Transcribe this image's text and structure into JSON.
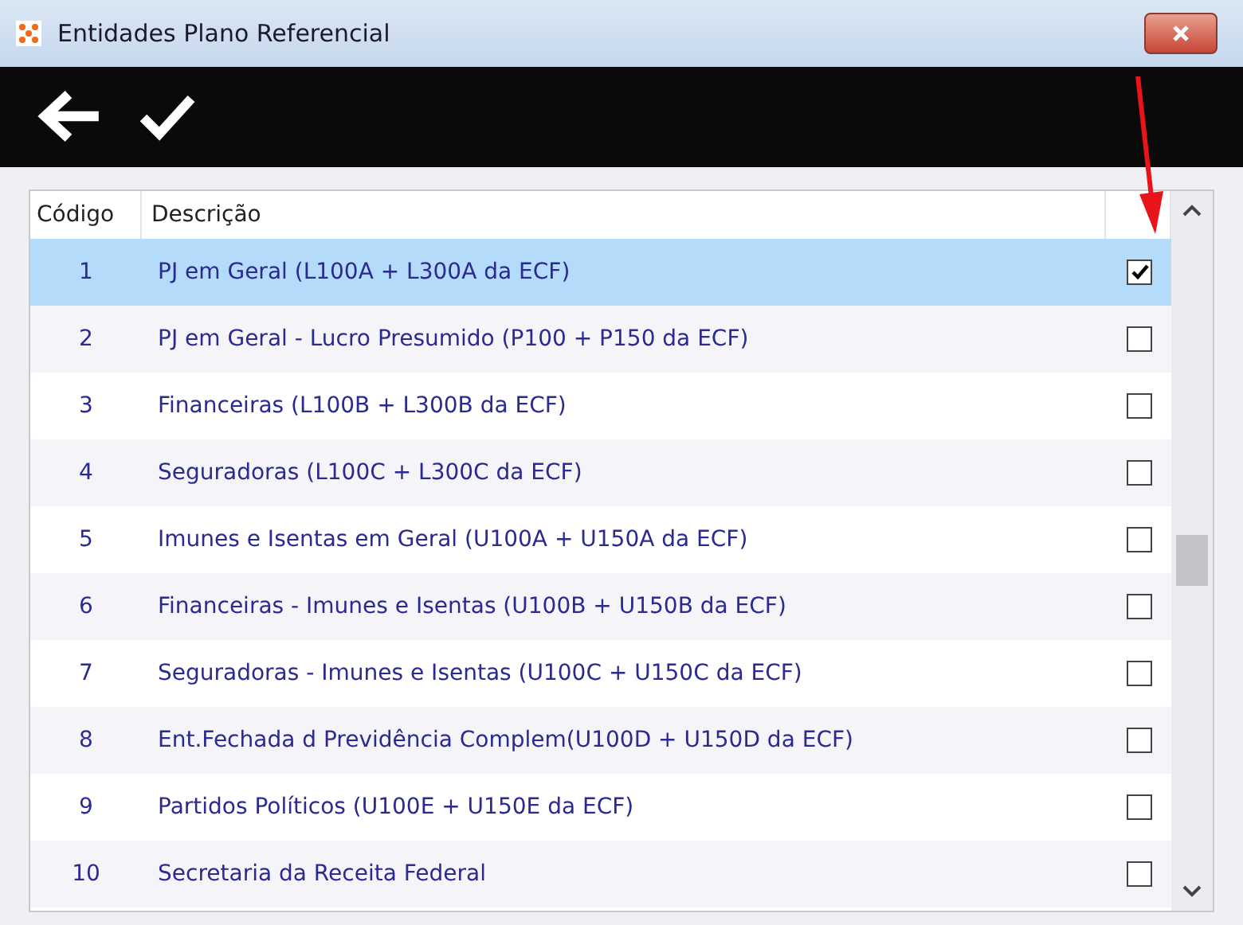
{
  "window": {
    "title": "Entidades Plano Referencial"
  },
  "table": {
    "columns": [
      "Código",
      "Descrição"
    ],
    "rows": [
      {
        "code": "1",
        "description": "PJ em Geral (L100A + L300A da ECF)",
        "checked": true,
        "selected": true
      },
      {
        "code": "2",
        "description": "PJ em Geral - Lucro Presumido (P100 + P150 da ECF)",
        "checked": false,
        "selected": false
      },
      {
        "code": "3",
        "description": "Financeiras (L100B + L300B da ECF)",
        "checked": false,
        "selected": false
      },
      {
        "code": "4",
        "description": "Seguradoras (L100C + L300C da ECF)",
        "checked": false,
        "selected": false
      },
      {
        "code": "5",
        "description": "Imunes e Isentas em Geral (U100A + U150A da ECF)",
        "checked": false,
        "selected": false
      },
      {
        "code": "6",
        "description": "Financeiras - Imunes e Isentas (U100B + U150B da ECF)",
        "checked": false,
        "selected": false
      },
      {
        "code": "7",
        "description": "Seguradoras - Imunes e Isentas (U100C + U150C da ECF)",
        "checked": false,
        "selected": false
      },
      {
        "code": "8",
        "description": "Ent.Fechada d Previdência Complem(U100D + U150D da ECF)",
        "checked": false,
        "selected": false
      },
      {
        "code": "9",
        "description": "Partidos Políticos (U100E + U150E da ECF)",
        "checked": false,
        "selected": false
      },
      {
        "code": "10",
        "description": "Secretaria da Receita Federal",
        "checked": false,
        "selected": false
      }
    ]
  }
}
